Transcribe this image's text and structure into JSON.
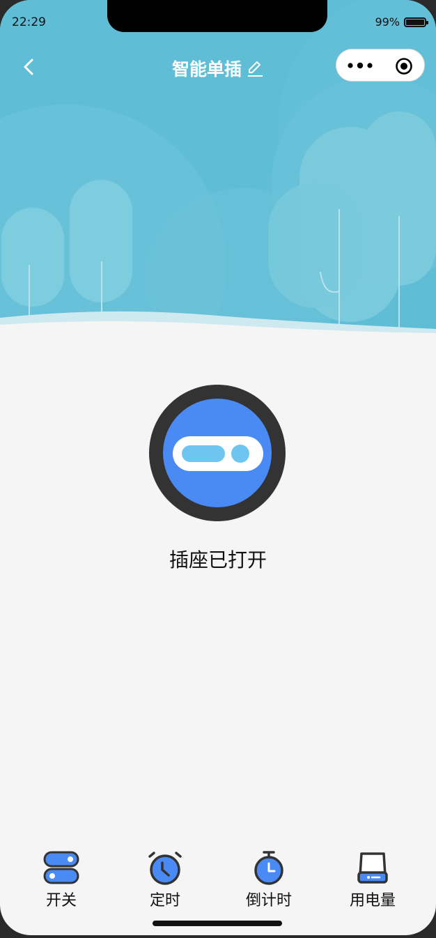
{
  "status_bar": {
    "time": "22:29",
    "battery": "99%"
  },
  "nav": {
    "title": "智能单插"
  },
  "colors": {
    "sky": "#5fbdd6",
    "accent": "#4a8af4",
    "light_blue": "#6ec6f0",
    "dark_ring": "#333333"
  },
  "device": {
    "power_on": true,
    "status_text": "插座已打开"
  },
  "tabs": [
    {
      "label": "开关",
      "icon": "toggle-switch-icon"
    },
    {
      "label": "定时",
      "icon": "alarm-clock-icon"
    },
    {
      "label": "倒计时",
      "icon": "stopwatch-icon"
    },
    {
      "label": "用电量",
      "icon": "power-bank-icon"
    }
  ]
}
